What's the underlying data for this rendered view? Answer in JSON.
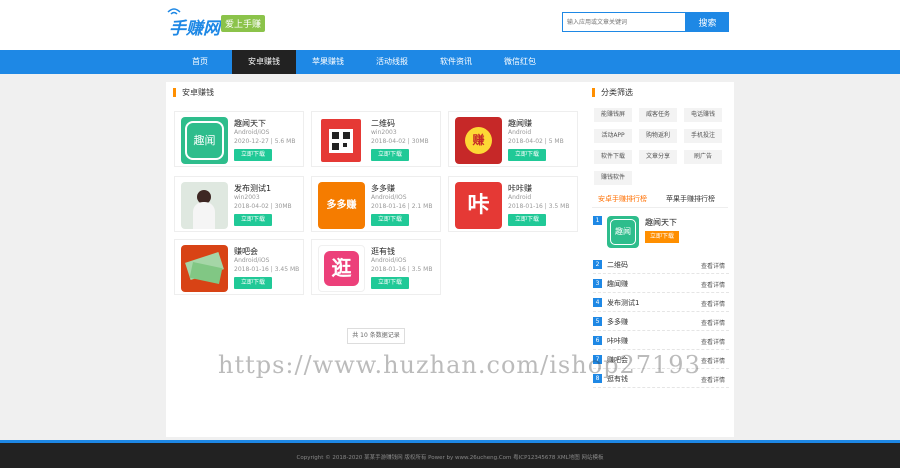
{
  "header": {
    "logo_text": "手赚网",
    "logo_badge": "爱上手赚",
    "search_placeholder": "输入应用或文章关键词",
    "search_button": "搜索"
  },
  "nav": {
    "items": [
      {
        "label": "首页"
      },
      {
        "label": "安卓赚钱"
      },
      {
        "label": "苹果赚钱"
      },
      {
        "label": "活动线报"
      },
      {
        "label": "软件资讯"
      },
      {
        "label": "微信红包"
      }
    ],
    "active_index": 1
  },
  "main": {
    "section_title": "安卓赚钱",
    "apps": [
      {
        "name": "趣闻天下",
        "platform": "Android/iOS",
        "meta": "2020-12-27 | 5.6 MB",
        "button": "立即下载",
        "icon_text": "趣闻"
      },
      {
        "name": "二维码",
        "platform": "win2003",
        "meta": "2018-04-02 | 30MB",
        "button": "立即下载",
        "icon_text": ""
      },
      {
        "name": "趣闻赚",
        "platform": "Android",
        "meta": "2018-04-02 | 5 MB",
        "button": "立即下载",
        "icon_text": "赚"
      },
      {
        "name": "发布测试1",
        "platform": "win2003",
        "meta": "2018-04-02 | 30MB",
        "button": "立即下载",
        "icon_text": ""
      },
      {
        "name": "多多赚",
        "platform": "Android/IOS",
        "meta": "2018-01-16 | 2.1 MB",
        "button": "立即下载",
        "icon_text": "多多赚"
      },
      {
        "name": "咔咔赚",
        "platform": "Android",
        "meta": "2018-01-16 | 3.5 MB",
        "button": "立即下载",
        "icon_text": "咔"
      },
      {
        "name": "赚吧会",
        "platform": "Android/iOS",
        "meta": "2018-01-16 | 3.45 MB",
        "button": "立即下载",
        "icon_text": ""
      },
      {
        "name": "逛有钱",
        "platform": "Android/iOS",
        "meta": "2018-01-16 | 3.5 MB",
        "button": "立即下载",
        "icon_text": "逛"
      }
    ],
    "pager": "共 10 条数据记录"
  },
  "sidebar": {
    "category_title": "分类筛选",
    "tags": [
      "能赚钱屏",
      "威客任务",
      "电话赚钱",
      "活动APP",
      "购物返利",
      "手机投注",
      "软件下载",
      "文章分享",
      "刷广告",
      "赚钱软件"
    ],
    "rank_tabs": [
      "安卓手赚排行榜",
      "苹果手赚排行榜"
    ],
    "rank_top": {
      "name": "趣闻天下",
      "button": "立即下载",
      "icon_text": "趣闻"
    },
    "rank": [
      {
        "num": "2",
        "name": "二维码",
        "more": "查看详情"
      },
      {
        "num": "3",
        "name": "趣闻赚",
        "more": "查看详情"
      },
      {
        "num": "4",
        "name": "发布测试1",
        "more": "查看详情"
      },
      {
        "num": "5",
        "name": "多多赚",
        "more": "查看详情"
      },
      {
        "num": "6",
        "name": "咔咔赚",
        "more": "查看详情"
      },
      {
        "num": "7",
        "name": "赚吧会",
        "more": "查看详情"
      },
      {
        "num": "8",
        "name": "逛有钱",
        "more": "查看详情"
      }
    ]
  },
  "watermark": "https://www.huzhan.com/ishop27193",
  "footer": {
    "text": "Copyright © 2018-2020 某某手游赚钱网 版权所有 Power by www.26ucheng.Com 粤ICP12345678 XML地图 网站模板"
  },
  "colors": {
    "brand": "#1e88e5",
    "accent": "#ff8f00",
    "download": "#20c997",
    "badge": "#8bc34a"
  }
}
